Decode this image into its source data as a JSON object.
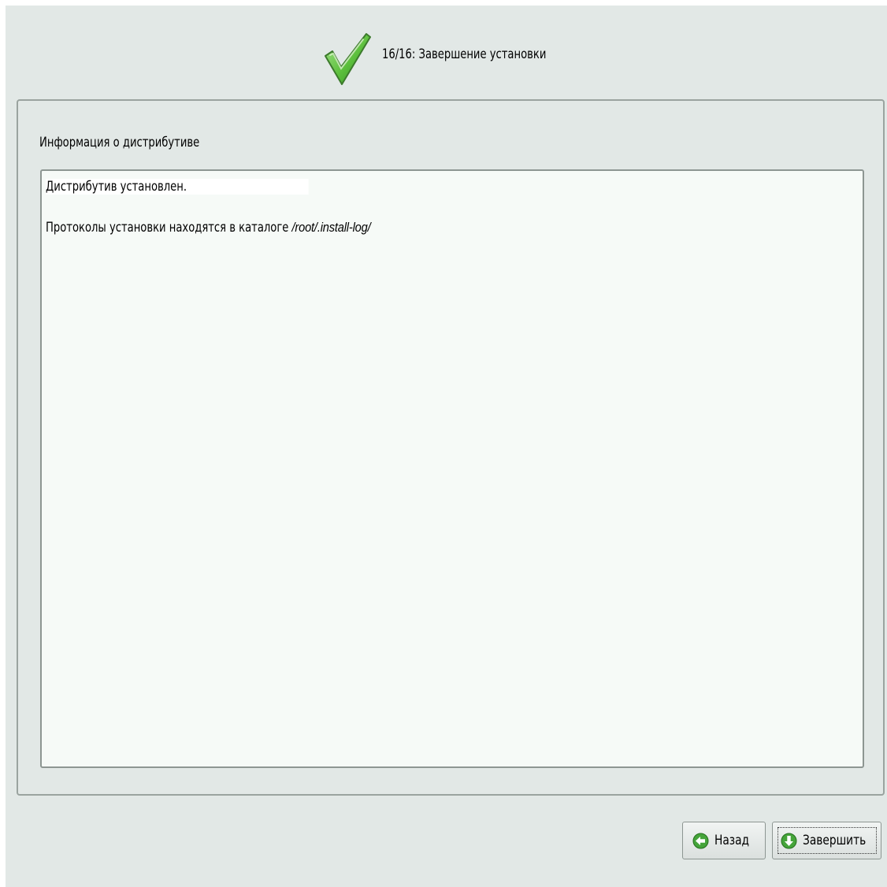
{
  "header": {
    "icon": "checkmark-icon",
    "step_title": "16/16: Завершение установки"
  },
  "panel": {
    "section_label": "Информация о дистрибутиве",
    "info": {
      "line1": "Дистрибутив установлен.",
      "line2_prefix": "Протоколы установки находятся в каталоге ",
      "line2_path": "/root/.install-log/"
    }
  },
  "buttons": {
    "back": {
      "label": "Назад",
      "icon": "arrow-left-icon"
    },
    "finish": {
      "label": "Завершить",
      "icon": "arrow-down-icon"
    }
  },
  "colors": {
    "background": "#e2e8e6",
    "info_box": "#f6faf7",
    "icon_green": "#3aa33a"
  }
}
